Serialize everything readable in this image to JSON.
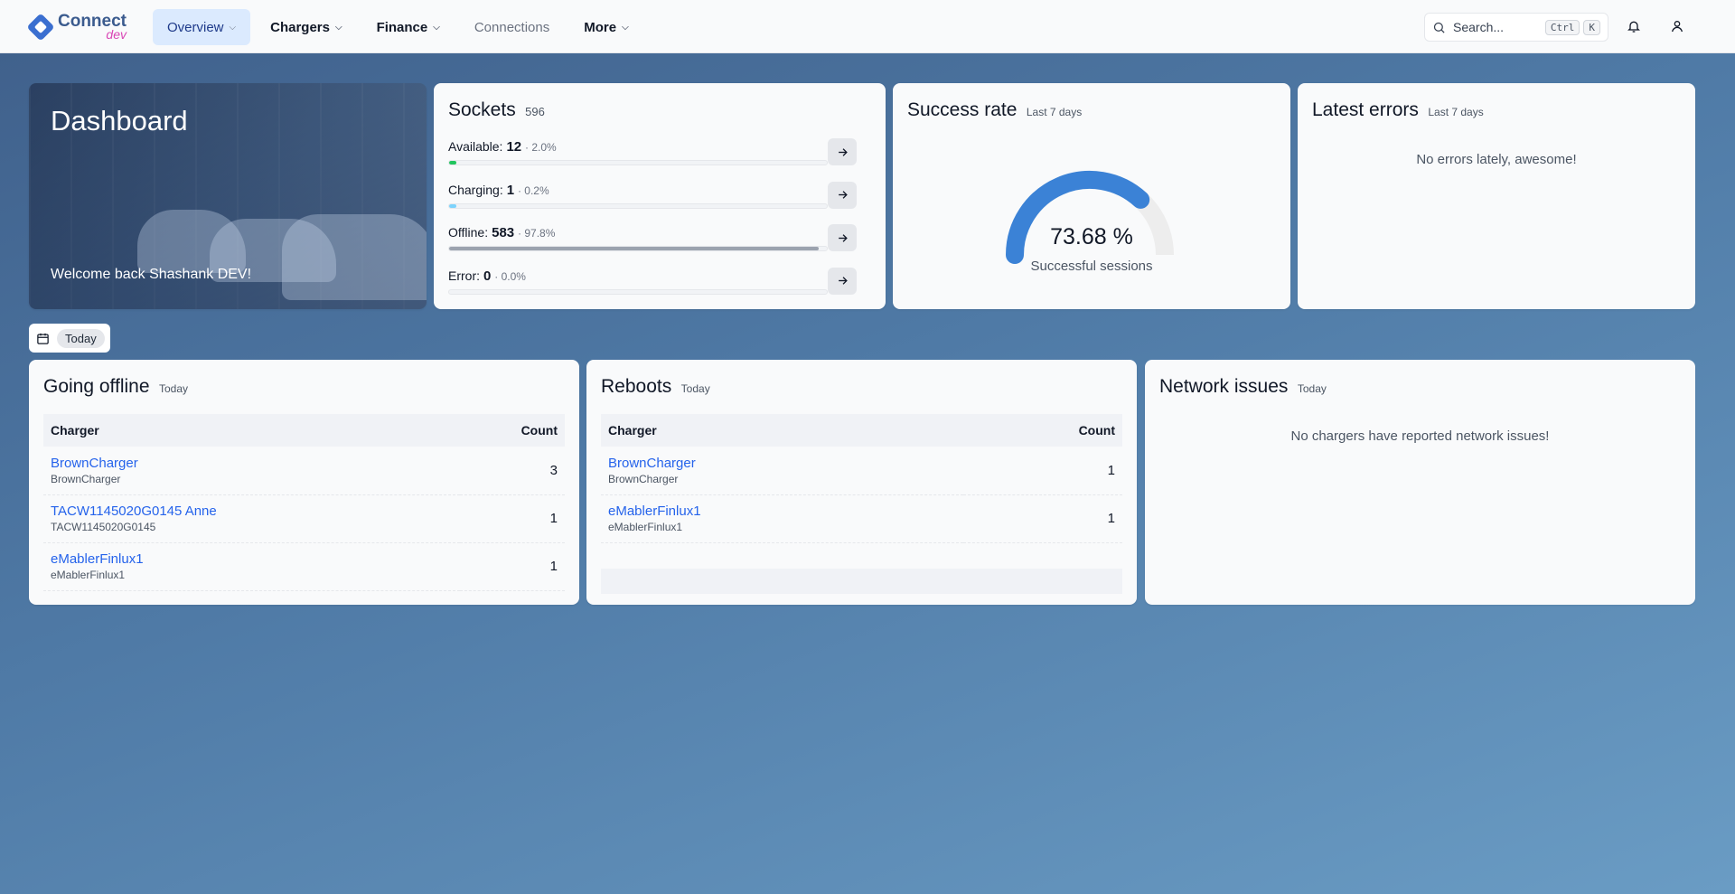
{
  "header": {
    "logo": {
      "name": "Connect",
      "env": "dev"
    },
    "nav": [
      {
        "label": "Overview",
        "dropdown": true
      },
      {
        "label": "Chargers",
        "dropdown": true
      },
      {
        "label": "Finance",
        "dropdown": true
      },
      {
        "label": "Connections",
        "dropdown": false
      },
      {
        "label": "More",
        "dropdown": true
      }
    ],
    "search": {
      "placeholder": "Search...",
      "key1": "Ctrl",
      "key2": "K"
    }
  },
  "hero": {
    "title": "Dashboard",
    "welcome": "Welcome back Shashank DEV!"
  },
  "sockets": {
    "title": "Sockets",
    "total": "596",
    "rows": [
      {
        "label": "Available:",
        "count": "12",
        "pct": "· 2.0%",
        "fraction": 0.02,
        "color": "#22c55e"
      },
      {
        "label": "Charging:",
        "count": "1",
        "pct": "· 0.2%",
        "fraction": 0.002,
        "color": "#7dd3fc"
      },
      {
        "label": "Offline:",
        "count": "583",
        "pct": "· 97.8%",
        "fraction": 0.978,
        "color": "#9ca3af"
      },
      {
        "label": "Error:",
        "count": "0",
        "pct": "· 0.0%",
        "fraction": 0.0,
        "color": "#ef4444"
      }
    ]
  },
  "success_rate": {
    "title": "Success rate",
    "period": "Last 7 days",
    "value": "73.68 %",
    "fraction": 0.7368,
    "caption": "Successful sessions"
  },
  "latest_errors": {
    "title": "Latest errors",
    "period": "Last 7 days",
    "empty": "No errors lately, awesome!"
  },
  "date_filter": {
    "label": "Today"
  },
  "going_offline": {
    "title": "Going offline",
    "period": "Today",
    "columns": [
      "Charger",
      "Count"
    ],
    "rows": [
      {
        "name": "BrownCharger",
        "sub": "BrownCharger",
        "count": "3"
      },
      {
        "name": "TACW1145020G0145 Anne",
        "sub": "TACW1145020G0145",
        "count": "1"
      },
      {
        "name": "eMablerFinlux1",
        "sub": "eMablerFinlux1",
        "count": "1"
      }
    ]
  },
  "reboots": {
    "title": "Reboots",
    "period": "Today",
    "columns": [
      "Charger",
      "Count"
    ],
    "rows": [
      {
        "name": "BrownCharger",
        "sub": "BrownCharger",
        "count": "1"
      },
      {
        "name": "eMablerFinlux1",
        "sub": "eMablerFinlux1",
        "count": "1"
      }
    ]
  },
  "network_issues": {
    "title": "Network issues",
    "period": "Today",
    "empty": "No chargers have reported network issues!"
  }
}
